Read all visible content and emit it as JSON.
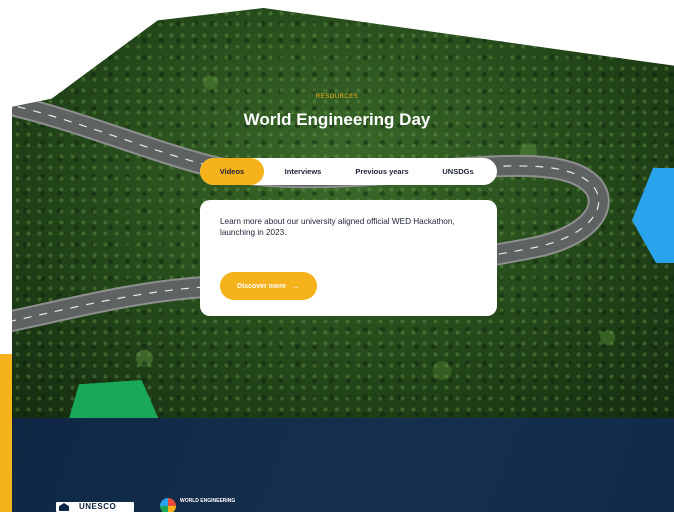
{
  "hero": {
    "eyebrow": "RESOURCES",
    "title": "World Engineering Day"
  },
  "tabs": [
    {
      "label": "Videos",
      "active": true
    },
    {
      "label": "Interviews",
      "active": false
    },
    {
      "label": "Previous years",
      "active": false
    },
    {
      "label": "UNSDGs",
      "active": false
    }
  ],
  "card": {
    "text": "Learn more about our university aligned official WED Hackathon, launching in 2023.",
    "button_label": "Discover more",
    "button_arrow": "→"
  },
  "footer": {
    "unesco_logo_text": "UNESCO",
    "wed_logo_text": "WORLD ENGINEERING"
  },
  "colors": {
    "accent_yellow": "#f6b21a",
    "accent_blue": "#29a3ec",
    "accent_green": "#19a85a",
    "footer_navy": "#0f2744",
    "text_dark": "#1d2338"
  }
}
